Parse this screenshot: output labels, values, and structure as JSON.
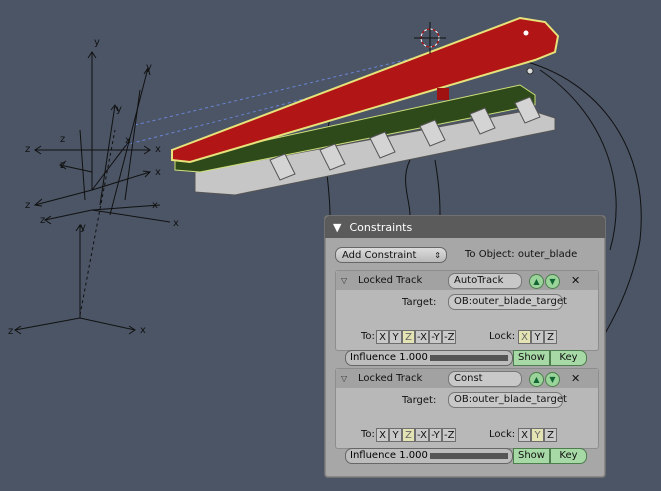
{
  "viewport": {
    "axis_labels": [
      "x",
      "y",
      "z"
    ]
  },
  "panel": {
    "title": "Constraints",
    "add_constraint": "Add Constraint",
    "to_object": "To Object: outer_blade",
    "constraints": [
      {
        "type": "Locked Track",
        "name": "AutoTrack",
        "target_label": "Target:",
        "target": "OB:outer_blade_target",
        "to_label": "To:",
        "to_axes": [
          "X",
          "Y",
          "Z",
          "-X",
          "-Y",
          "-Z"
        ],
        "to_selected": "Z",
        "lock_label": "Lock:",
        "lock_axes": [
          "X",
          "Y",
          "Z"
        ],
        "lock_selected": "X",
        "influence": "Influence 1.000",
        "show": "Show",
        "key": "Key"
      },
      {
        "type": "Locked Track",
        "name": "Const",
        "target_label": "Target:",
        "target": "OB:outer_blade_target",
        "to_label": "To:",
        "to_axes": [
          "X",
          "Y",
          "Z",
          "-X",
          "-Y",
          "-Z"
        ],
        "to_selected": "Z",
        "lock_label": "Lock:",
        "lock_axes": [
          "X",
          "Y",
          "Z"
        ],
        "lock_selected": "Y",
        "influence": "Influence 1.000",
        "show": "Show",
        "key": "Key"
      }
    ]
  }
}
